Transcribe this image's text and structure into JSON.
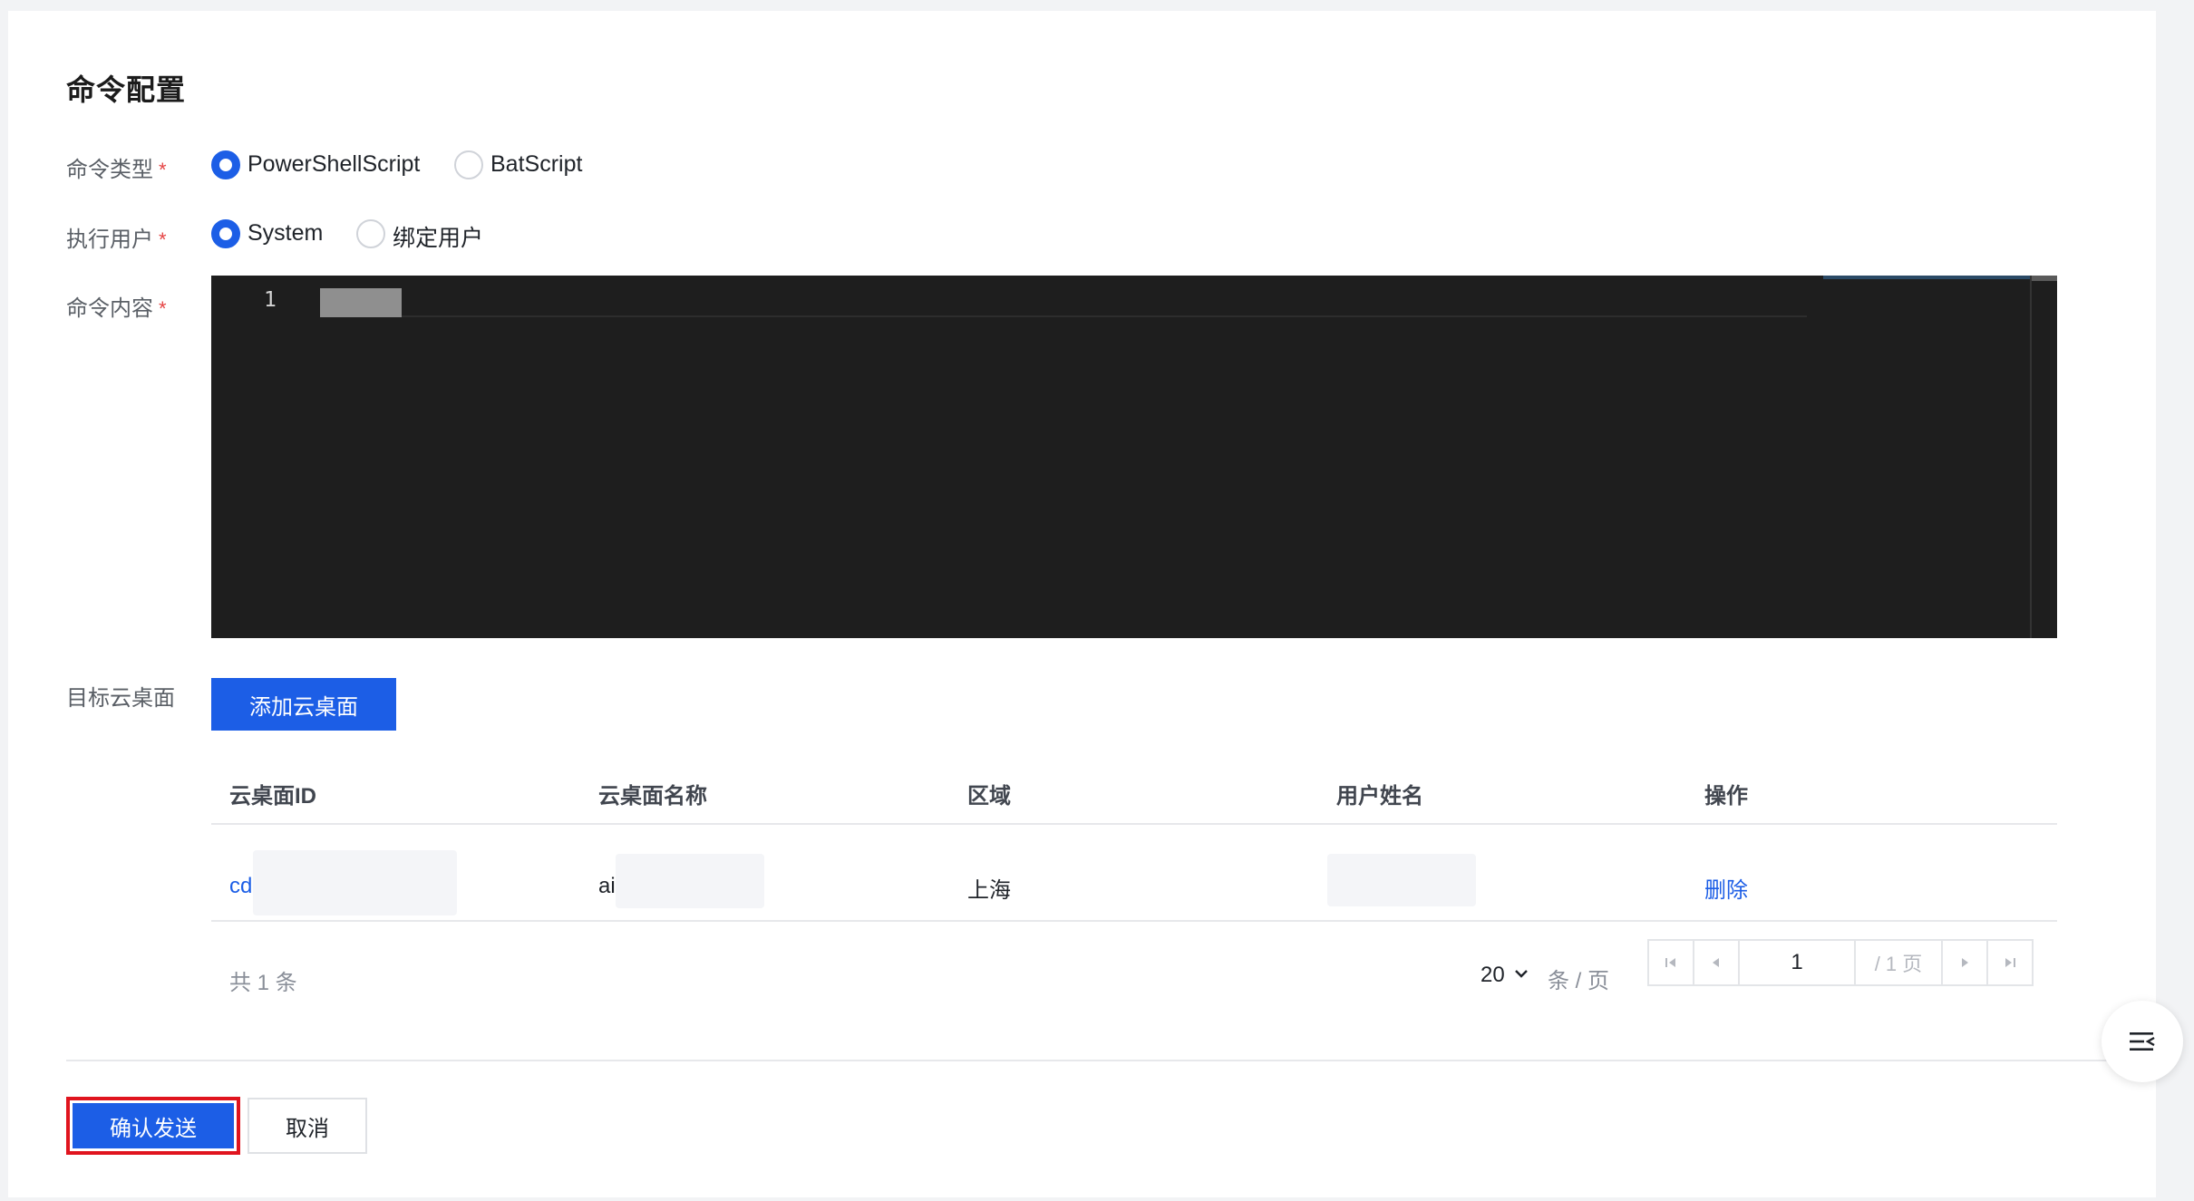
{
  "section_title": "命令配置",
  "form": {
    "command_type": {
      "label": "命令类型",
      "required_mark": "*",
      "options": [
        "PowerShellScript",
        "BatScript"
      ],
      "selected": "PowerShellScript"
    },
    "exec_user": {
      "label": "执行用户",
      "required_mark": "*",
      "options": [
        "System",
        "绑定用户"
      ],
      "selected": "System"
    },
    "command_content": {
      "label": "命令内容",
      "required_mark": "*",
      "line_numbers": [
        "1"
      ]
    },
    "target_desktop": {
      "label": "目标云桌面",
      "add_button": "添加云桌面"
    }
  },
  "table": {
    "columns": [
      "云桌面ID",
      "云桌面名称",
      "区域",
      "用户姓名",
      "操作"
    ],
    "rows": [
      {
        "id": "cd",
        "name": "ai",
        "region": "上海",
        "user": "",
        "action": "删除"
      }
    ]
  },
  "pagination": {
    "total_text": "共 1 条",
    "page_size": "20",
    "page_size_unit": "条 / 页",
    "current_page": "1",
    "total_pages_text": "/ 1 页"
  },
  "footer": {
    "confirm_label": "确认发送",
    "cancel_label": "取消"
  },
  "colors": {
    "primary": "#1c5ee6",
    "editor_bg": "#1e1e1e",
    "required": "#e54545",
    "highlight_border": "#e0141e"
  },
  "icons": {
    "float_menu": "menu-fold-icon",
    "page_size_caret": "chevron-down-icon",
    "first_page": "first-page-icon",
    "prev_page": "prev-page-icon",
    "next_page": "next-page-icon",
    "last_page": "last-page-icon"
  }
}
